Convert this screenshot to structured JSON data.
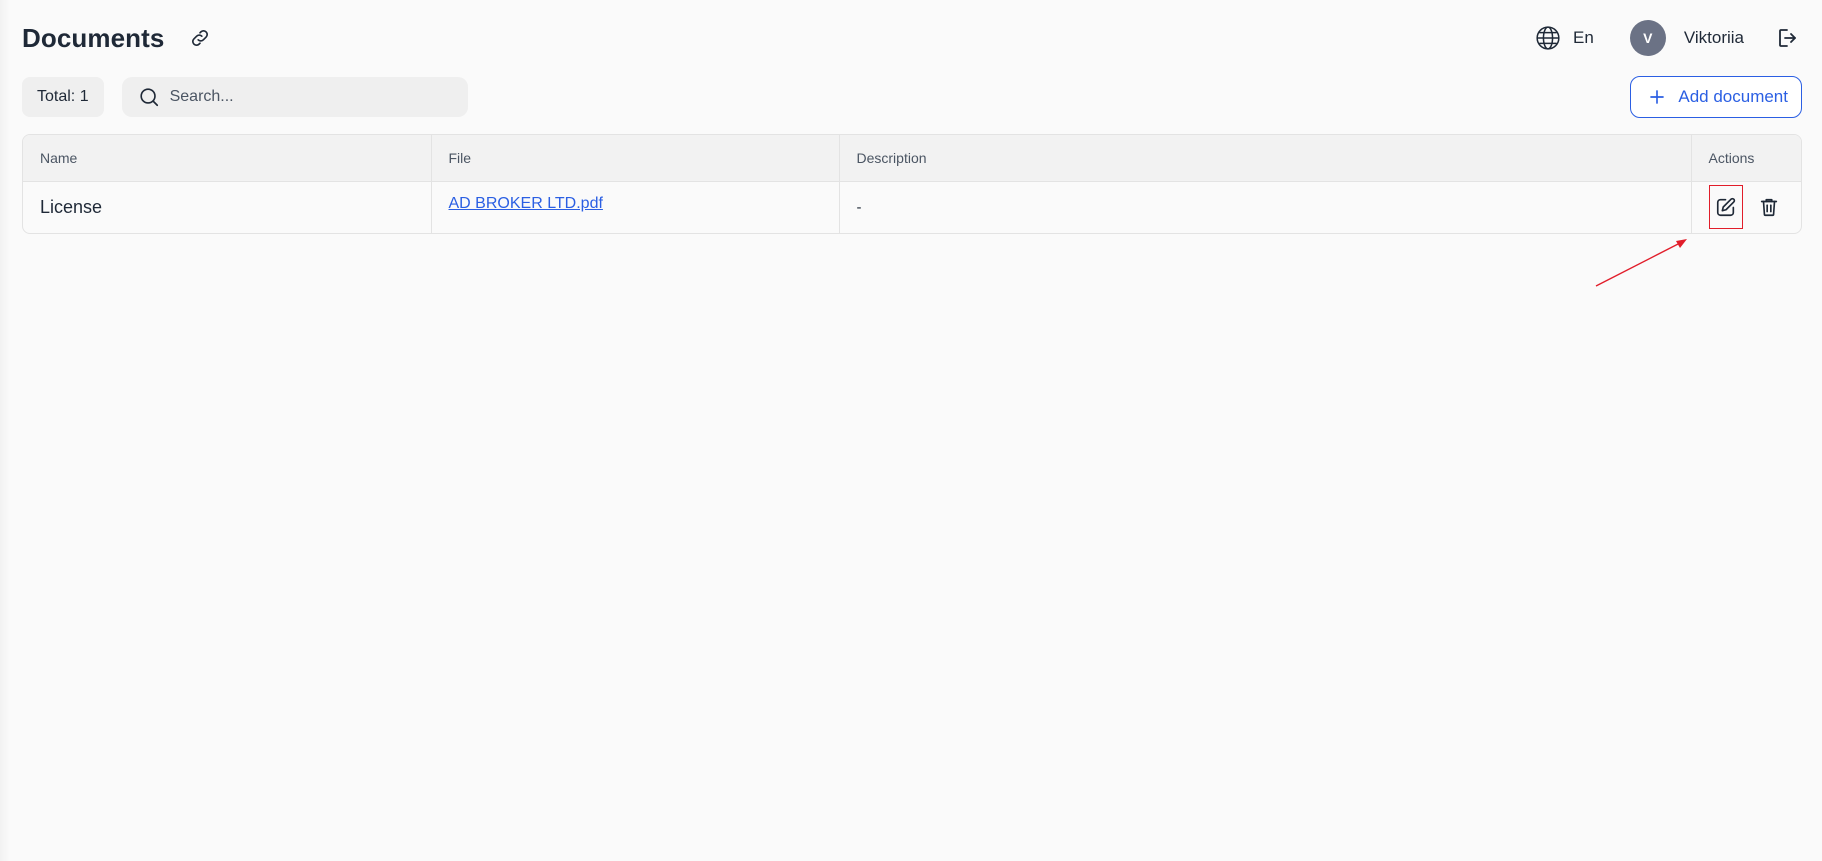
{
  "header": {
    "title": "Documents",
    "language": "En",
    "user": {
      "initial": "V",
      "name": "Viktoriia"
    }
  },
  "toolbar": {
    "total_label": "Total: 1",
    "search_placeholder": "Search...",
    "add_label": "Add document"
  },
  "table": {
    "columns": [
      "Name",
      "File",
      "Description",
      "Actions"
    ],
    "rows": [
      {
        "name": "License",
        "file": "AD BROKER LTD.pdf",
        "description": "-"
      }
    ]
  },
  "icons": {
    "link": "link-icon",
    "globe": "globe-icon",
    "logout": "logout-icon",
    "search": "search-icon",
    "plus": "plus-icon",
    "edit": "edit-icon",
    "delete": "trash-icon"
  },
  "colors": {
    "accent": "#2b5fe3",
    "avatar": "#6b7285",
    "highlight": "#e11d2a"
  }
}
